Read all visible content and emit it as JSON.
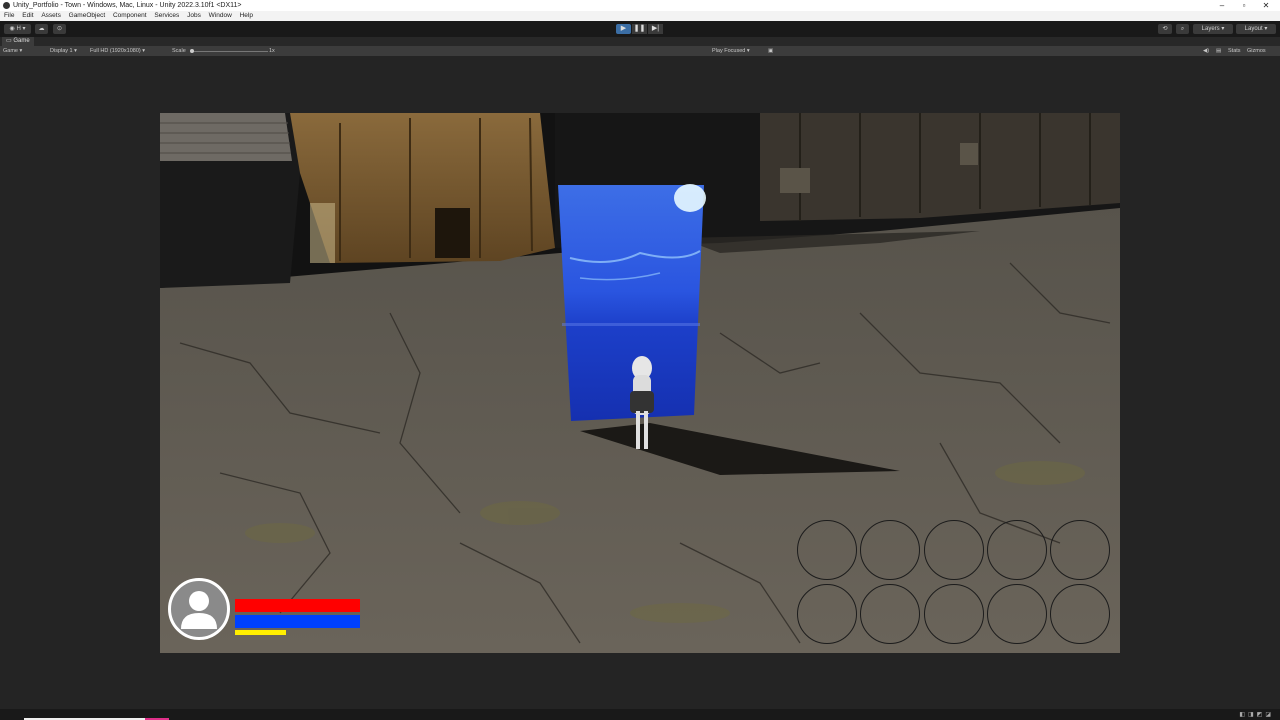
{
  "window": {
    "title": "Unity_Portfolio - Town - Windows, Mac, Linux - Unity 2022.3.10f1 <DX11>",
    "controls": [
      "–",
      "▫",
      "✕"
    ]
  },
  "menu": [
    "File",
    "Edit",
    "Assets",
    "GameObject",
    "Component",
    "Services",
    "Jobs",
    "Window",
    "Help"
  ],
  "toolbar": {
    "account_label": "H",
    "layers_label": "Layers",
    "layout_label": "Layout"
  },
  "game_tab": {
    "label": "Game"
  },
  "game_controls": {
    "view_dropdown": "Game",
    "display": "Display 1",
    "resolution": "Full HD (1920x1080)",
    "scale_label": "Scale",
    "scale_value": "1x",
    "play_focused": "Play Focused",
    "stats": "Stats",
    "gizmos": "Gizmos"
  },
  "hud": {
    "health_fraction": 1.0,
    "mana_fraction": 1.0,
    "exp_fraction": 0.41,
    "health_color": "#ff0000",
    "mana_color": "#0040ff",
    "exp_color": "#ffee00",
    "skill_slot_count": 10
  }
}
